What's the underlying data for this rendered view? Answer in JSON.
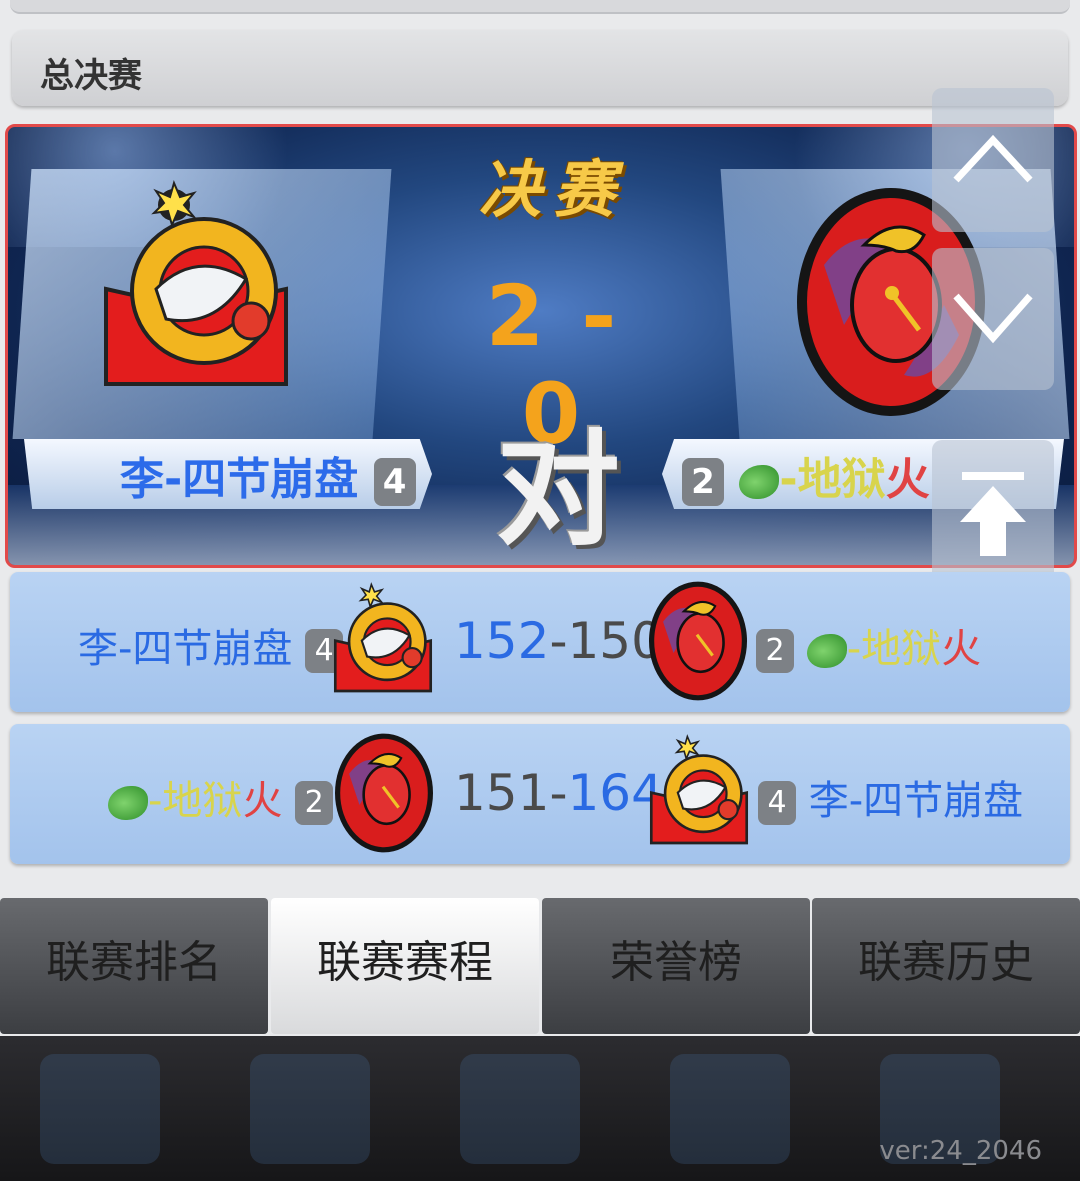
{
  "section": {
    "title": "总决赛"
  },
  "final": {
    "title": "决赛",
    "score": "2 - 0",
    "vs": "对",
    "home": {
      "name": "李-四节崩盘",
      "seed": "4"
    },
    "away": {
      "name_part1": "-地狱",
      "name_part2": "火",
      "seed": "2"
    }
  },
  "games": [
    {
      "left_team": "李-四节崩盘",
      "left_seed": "4",
      "score_left": "152",
      "score_sep": "-",
      "score_right": "150",
      "right_seed": "2",
      "right_team_part1": "-地狱",
      "right_team_part2": "火"
    },
    {
      "left_team_part1": "-地狱",
      "left_team_part2": "火",
      "left_seed": "2",
      "score_left": "151",
      "score_sep": "-",
      "score_right": "164",
      "right_seed": "4",
      "right_team": "李-四节崩盘"
    }
  ],
  "tabs": [
    {
      "label": "联赛排名",
      "active": false
    },
    {
      "label": "联赛赛程",
      "active": true
    },
    {
      "label": "荣誉榜",
      "active": false
    },
    {
      "label": "联赛历史",
      "active": false
    }
  ],
  "version": "ver:24_2046",
  "colors": {
    "accent_blue": "#2a6ae3",
    "score_orange": "#f4a31c",
    "highlight_border": "#e24a4a"
  },
  "icons": [
    "shark-team-logo",
    "knight-team-logo",
    "lettuce-icon",
    "scroll-up-icon",
    "scroll-down-icon",
    "scroll-top-icon"
  ]
}
